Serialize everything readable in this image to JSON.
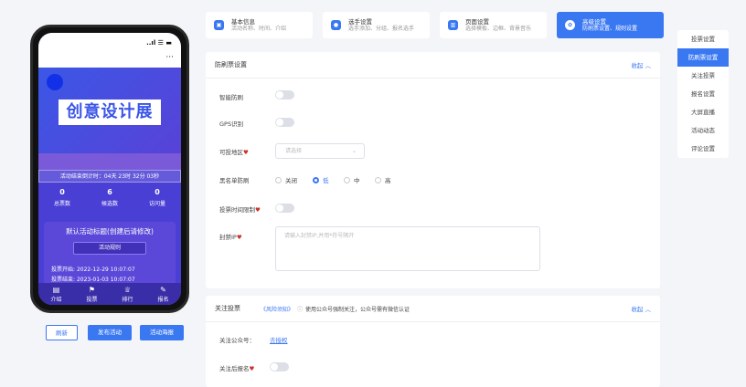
{
  "phone": {
    "status_time": "",
    "status_icons": "..ıl ☰ ▬",
    "menu_dots": "···",
    "banner_title": "创意设计展",
    "countdown": "活动结束倒计时：04天 23时 32分 03秒",
    "stats": [
      {
        "value": "0",
        "label": "总票数"
      },
      {
        "value": "6",
        "label": "候选数"
      },
      {
        "value": "0",
        "label": "访问量"
      }
    ],
    "card_title": "默认活动标题(创建后请修改)",
    "rule_label": "活动规则",
    "vote_start_label": "投票开始:",
    "vote_start": "2022-12-29 10:07:07",
    "vote_end_label": "投票结束:",
    "vote_end": "2023-01-03 10:07:07",
    "tabs": [
      {
        "icon": "▤",
        "label": "介绍"
      },
      {
        "icon": "⚑",
        "label": "投票"
      },
      {
        "icon": "♕",
        "label": "排行"
      },
      {
        "icon": "✎",
        "label": "报名"
      }
    ]
  },
  "phone_buttons": {
    "refresh": "刷新",
    "publish": "发布活动",
    "poster": "活动海报"
  },
  "steps": [
    {
      "title": "基本信息",
      "desc": "活动名称、时间、介绍"
    },
    {
      "title": "选手设置",
      "desc": "选手添加、分组、报名选手"
    },
    {
      "title": "页面设置",
      "desc": "选择模板、边框、背景音乐"
    },
    {
      "title": "高级设置",
      "desc": "防刷票设置、规则设置"
    }
  ],
  "anti_cheat": {
    "title": "防刷票设置",
    "collapse": "收起",
    "smart_label": "智能防刷",
    "gps_label": "GPS识别",
    "region_label": "可投地区",
    "region_placeholder": "请选择",
    "blacklist_label": "黑名单防刷",
    "blacklist_options": [
      "关闭",
      "低",
      "中",
      "高"
    ],
    "time_limit_label": "投票时间限制",
    "ban_ip_label": "封禁IP",
    "ban_ip_placeholder": "请输入封禁IP,并用*符号隔开"
  },
  "follow": {
    "title": "关注投票",
    "risk_link": "《风险须知》",
    "note": "使用公众号强制关注，公众号需有微信认证",
    "collapse": "收起",
    "account_label": "关注公众号：",
    "authorize_link": "去授权",
    "after_follow_label": "关注后报名"
  },
  "side_menu": [
    "投票设置",
    "防刷票设置",
    "关注投票",
    "报名设置",
    "大屏直播",
    "活动动态",
    "评论设置"
  ],
  "colors": {
    "accent": "#3a78f2",
    "phone_bg": "#4a3fd4"
  }
}
